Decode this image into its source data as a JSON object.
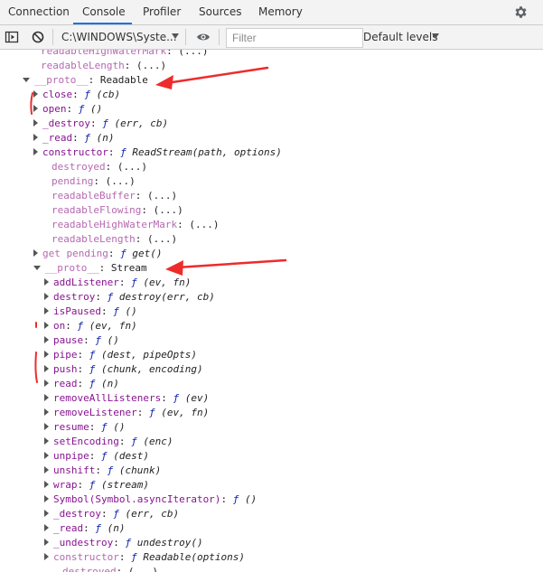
{
  "tabs": [
    {
      "label": "Connection"
    },
    {
      "label": "Console"
    },
    {
      "label": "Profiler"
    },
    {
      "label": "Sources"
    },
    {
      "label": "Memory"
    }
  ],
  "toolbar": {
    "context": "C:\\WINDOWS\\Syste...",
    "filter_placeholder": "Filter",
    "levels": "Default levels"
  },
  "colors": {
    "own_key": "#881391",
    "inherited_key": "#b569b0",
    "fn_marker": "#0d22aa",
    "annotation": "#ee2b2b",
    "active_tab": "#1a73e8"
  },
  "console": {
    "lines": [
      {
        "key": "readableHighWaterMark",
        "value": "(...)"
      },
      {
        "key": "readableLength",
        "value": "(...)"
      },
      {
        "key": "__proto__",
        "value": "Readable"
      },
      {
        "key": "close",
        "sig": "(cb)"
      },
      {
        "key": "open",
        "sig": "()"
      },
      {
        "key": "_destroy",
        "sig": "(err, cb)"
      },
      {
        "key": "_read",
        "sig": "(n)"
      },
      {
        "key": "constructor",
        "sig": "ReadStream(path, options)"
      },
      {
        "key": "destroyed",
        "value": "(...)"
      },
      {
        "key": "pending",
        "value": "(...)"
      },
      {
        "key": "readableBuffer",
        "value": "(...)"
      },
      {
        "key": "readableFlowing",
        "value": "(...)"
      },
      {
        "key": "readableHighWaterMark",
        "value": "(...)"
      },
      {
        "key": "readableLength",
        "value": "(...)"
      },
      {
        "key": "get pending",
        "sig": "get()"
      },
      {
        "key": "__proto__",
        "value": "Stream"
      },
      {
        "key": "addListener",
        "sig": "(ev, fn)"
      },
      {
        "key": "destroy",
        "sig": "destroy(err, cb)"
      },
      {
        "key": "isPaused",
        "sig": "()"
      },
      {
        "key": "on",
        "sig": "(ev, fn)"
      },
      {
        "key": "pause",
        "sig": "()"
      },
      {
        "key": "pipe",
        "sig": "(dest, pipeOpts)"
      },
      {
        "key": "push",
        "sig": "(chunk, encoding)"
      },
      {
        "key": "read",
        "sig": "(n)"
      },
      {
        "key": "removeAllListeners",
        "sig": "(ev)"
      },
      {
        "key": "removeListener",
        "sig": "(ev, fn)"
      },
      {
        "key": "resume",
        "sig": "()"
      },
      {
        "key": "setEncoding",
        "sig": "(enc)"
      },
      {
        "key": "unpipe",
        "sig": "(dest)"
      },
      {
        "key": "unshift",
        "sig": "(chunk)"
      },
      {
        "key": "wrap",
        "sig": "(stream)"
      },
      {
        "key": "Symbol(Symbol.asyncIterator)",
        "sig": "()"
      },
      {
        "key": "_destroy",
        "sig": "(err, cb)"
      },
      {
        "key": "_read",
        "sig": "(n)"
      },
      {
        "key": "_undestroy",
        "sig": "undestroy()"
      },
      {
        "key": "constructor",
        "sig": "Readable(options)"
      },
      {
        "key": "destroyed",
        "value": "(...)"
      }
    ]
  }
}
